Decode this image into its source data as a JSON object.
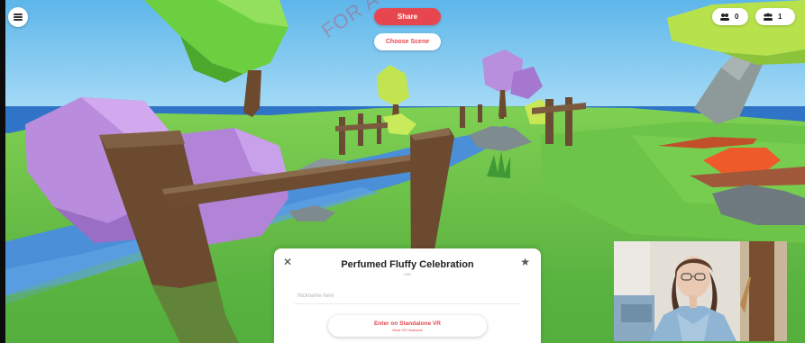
{
  "toolbar": {
    "menu_icon": "hamburger-icon",
    "share_label": "Share",
    "choose_scene_label": "Choose Scene"
  },
  "counters": [
    {
      "icon": "people-icon",
      "value": "0"
    },
    {
      "icon": "people-group-icon",
      "value": "1"
    }
  ],
  "watermark": "FOR AUTHOR",
  "room_card": {
    "title": "Perfumed Fluffy Celebration",
    "meta": "UNK",
    "input_placeholder": "Nickname here",
    "enter_button_label": "Enter on Standalone VR",
    "enter_button_sub": "Meta VR Headsets",
    "close_icon": "close-icon",
    "star_icon": "star-icon"
  },
  "colors": {
    "accent": "#e8464f",
    "sky": "#7ec8f0",
    "grass": "#68c24a",
    "water": "#4a8fd8"
  }
}
